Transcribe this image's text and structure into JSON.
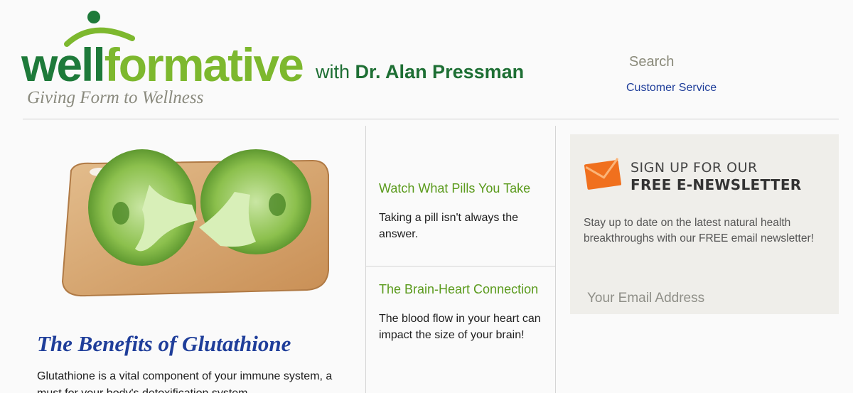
{
  "header": {
    "logo_part1": "well",
    "logo_part2": "formative",
    "with_prefix": "with ",
    "with_name": "Dr. Alan Pressman",
    "tagline": "Giving Form to Wellness",
    "search_label": "Search",
    "customer_service_label": "Customer Service"
  },
  "main_article": {
    "title": "The Benefits of Glutathione",
    "body": "Glutathione is a vital component of your immune system, a must for your body's detoxification system."
  },
  "side_stories": [
    {
      "title": "Watch What Pills You Take",
      "description": "Taking a pill isn't always the answer."
    },
    {
      "title": "The Brain-Heart Connection",
      "description": "The blood flow in your heart can impact the size of your brain!"
    }
  ],
  "newsletter": {
    "heading_line1": "SIGN UP FOR OUR",
    "heading_line2": "FREE E-NEWSLETTER",
    "description": "Stay up to date on the latest natural health breakthroughs with our FREE email newsletter!",
    "email_placeholder": "Your Email Address",
    "icon": "envelope-icon"
  },
  "colors": {
    "logo_dark_green": "#1e7a3a",
    "logo_light_green": "#7db82e",
    "link_blue": "#1f3e9a",
    "story_green": "#5a9a1c",
    "newsletter_bg": "#efeeea",
    "envelope_orange": "#f0701e"
  }
}
